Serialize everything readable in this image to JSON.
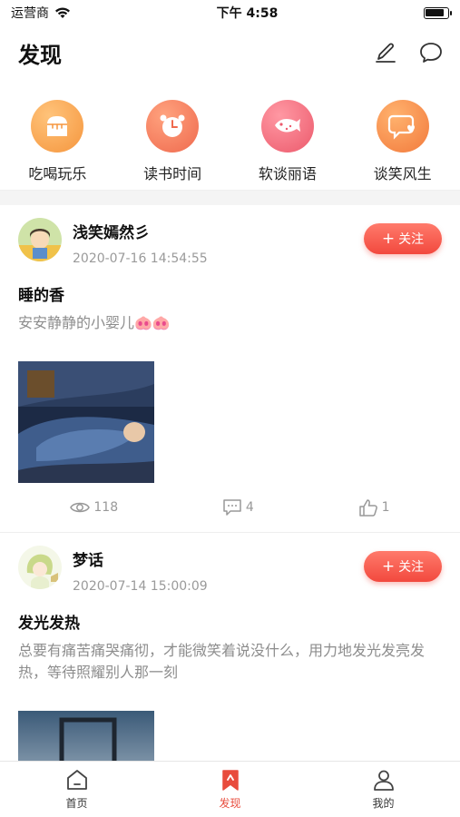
{
  "status_bar": {
    "carrier": "运营商",
    "time": "下午 4:58",
    "battery_level": 0.85
  },
  "header": {
    "title": "发现"
  },
  "categories": [
    {
      "label": "吃喝玩乐",
      "color": "#f5a04a",
      "icon": "bread-icon"
    },
    {
      "label": "读书时间",
      "color": "#f27b59",
      "icon": "alarm-clock-icon"
    },
    {
      "label": "软谈丽语",
      "color": "#f06a7a",
      "icon": "fish-bowl-icon"
    },
    {
      "label": "谈笑风生",
      "color": "#f5894a",
      "icon": "chat-heart-icon"
    }
  ],
  "posts": [
    {
      "author": "浅笑嫣然彡",
      "time": "2020-07-16 14:54:55",
      "follow_label": "关注",
      "title": "睡的香",
      "body": "安安静静的小婴儿🐽🐽",
      "views": "118",
      "comments": "4",
      "likes": "1"
    },
    {
      "author": "梦话",
      "time": "2020-07-14 15:00:09",
      "follow_label": "关注",
      "title": "发光发热",
      "body": "总要有痛苦痛哭痛彻，才能微笑着说没什么，用力地发光发亮发热，等待照耀别人那一刻"
    }
  ],
  "tabs": [
    {
      "label": "首页",
      "icon": "home-icon"
    },
    {
      "label": "发现",
      "icon": "bookmark-icon",
      "active": true
    },
    {
      "label": "我的",
      "icon": "user-icon"
    }
  ],
  "colors": {
    "accent": "#e84c3d",
    "follow_start": "#ff7a6b",
    "follow_end": "#f2493e"
  }
}
